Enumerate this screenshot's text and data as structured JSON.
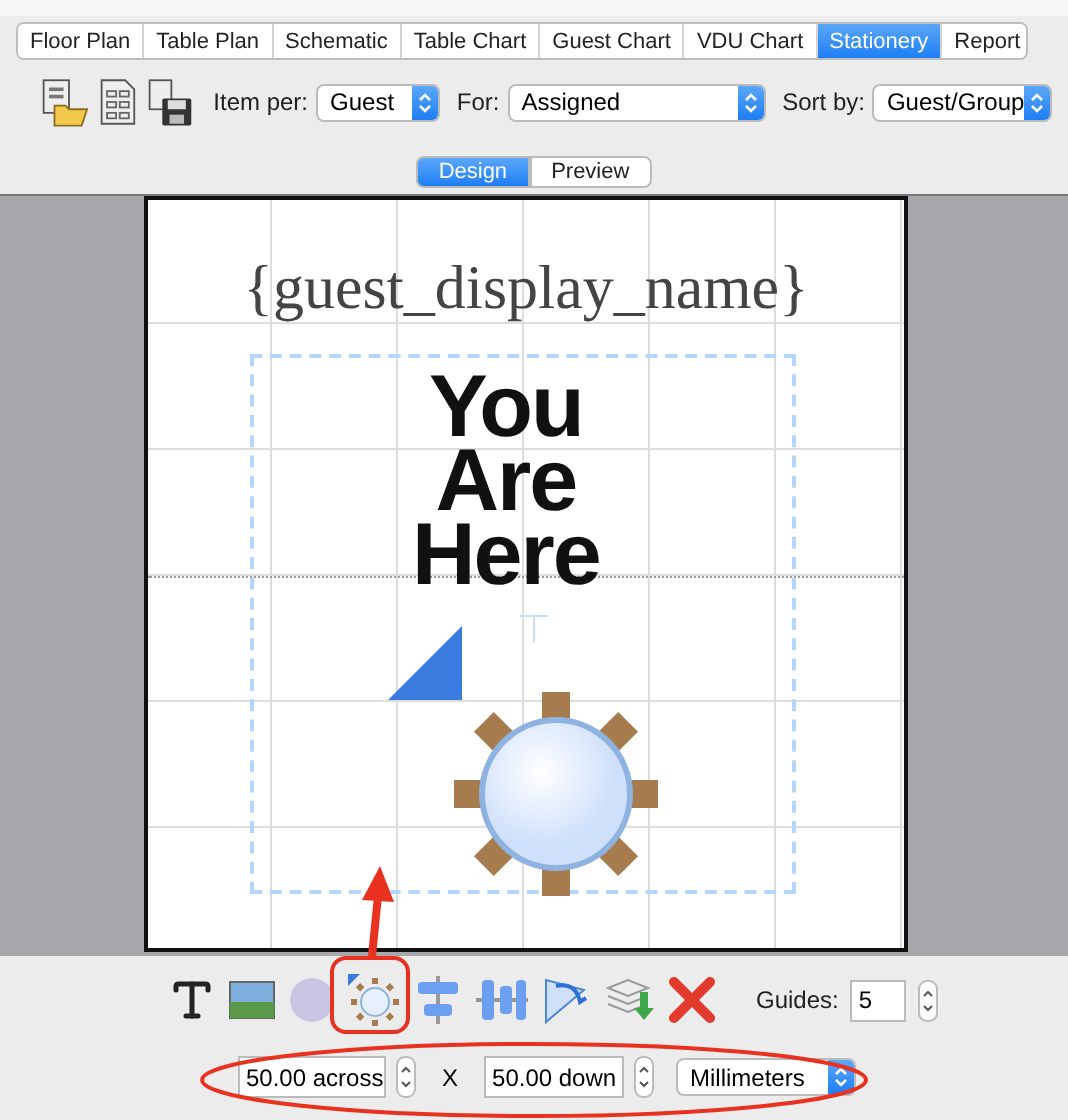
{
  "tabs": [
    {
      "label": "Floor Plan",
      "selected": false
    },
    {
      "label": "Table Plan",
      "selected": false
    },
    {
      "label": "Schematic",
      "selected": false
    },
    {
      "label": "Table Chart",
      "selected": false
    },
    {
      "label": "Guest Chart",
      "selected": false
    },
    {
      "label": "VDU Chart",
      "selected": false
    },
    {
      "label": "Stationery",
      "selected": true
    },
    {
      "label": "Report",
      "selected": false
    }
  ],
  "toolbar": {
    "selects": [
      {
        "label": "Item per:",
        "value": "Guest"
      },
      {
        "label": "For:",
        "value": "Assigned"
      },
      {
        "label": "Sort by:",
        "value": "Guest/Group"
      }
    ]
  },
  "view_toggle": [
    {
      "label": "Design",
      "selected": true
    },
    {
      "label": "Preview",
      "selected": false
    }
  ],
  "canvas": {
    "title": "{guest_display_name}",
    "sign_lines": [
      "You",
      "Are",
      "Here"
    ]
  },
  "guides": {
    "label": "Guides:",
    "value": "5"
  },
  "size": {
    "across": "50.00 across",
    "separator": "X",
    "down": "50.00 down",
    "units": "Millimeters"
  }
}
